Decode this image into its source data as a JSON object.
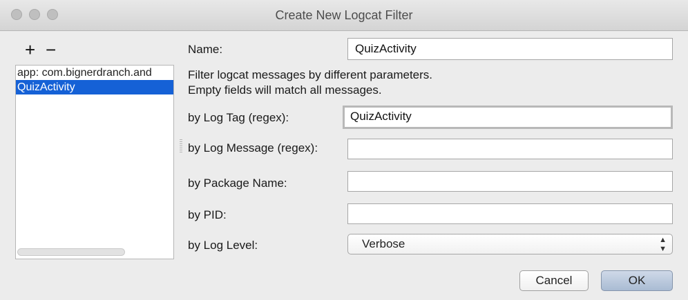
{
  "window": {
    "title": "Create New Logcat Filter"
  },
  "sidebar": {
    "add_label": "+",
    "remove_label": "−",
    "items": [
      {
        "label": "app: com.bignerdranch.and",
        "selected": false
      },
      {
        "label": "QuizActivity",
        "selected": true
      }
    ]
  },
  "form": {
    "name": {
      "label": "Name:",
      "value": "QuizActivity"
    },
    "description_line1": "Filter logcat messages by different parameters.",
    "description_line2": "Empty fields will match all messages.",
    "log_tag": {
      "label": "by Log Tag (regex):",
      "value": "QuizActivity"
    },
    "log_message": {
      "label": "by Log Message (regex):",
      "value": ""
    },
    "package_name": {
      "label": "by Package Name:",
      "value": ""
    },
    "pid": {
      "label": "by PID:",
      "value": ""
    },
    "log_level": {
      "label": "by Log Level:",
      "value": "Verbose"
    }
  },
  "buttons": {
    "cancel": "Cancel",
    "ok": "OK"
  },
  "colors": {
    "selection": "#1561d6",
    "window_bg": "#ececec"
  }
}
